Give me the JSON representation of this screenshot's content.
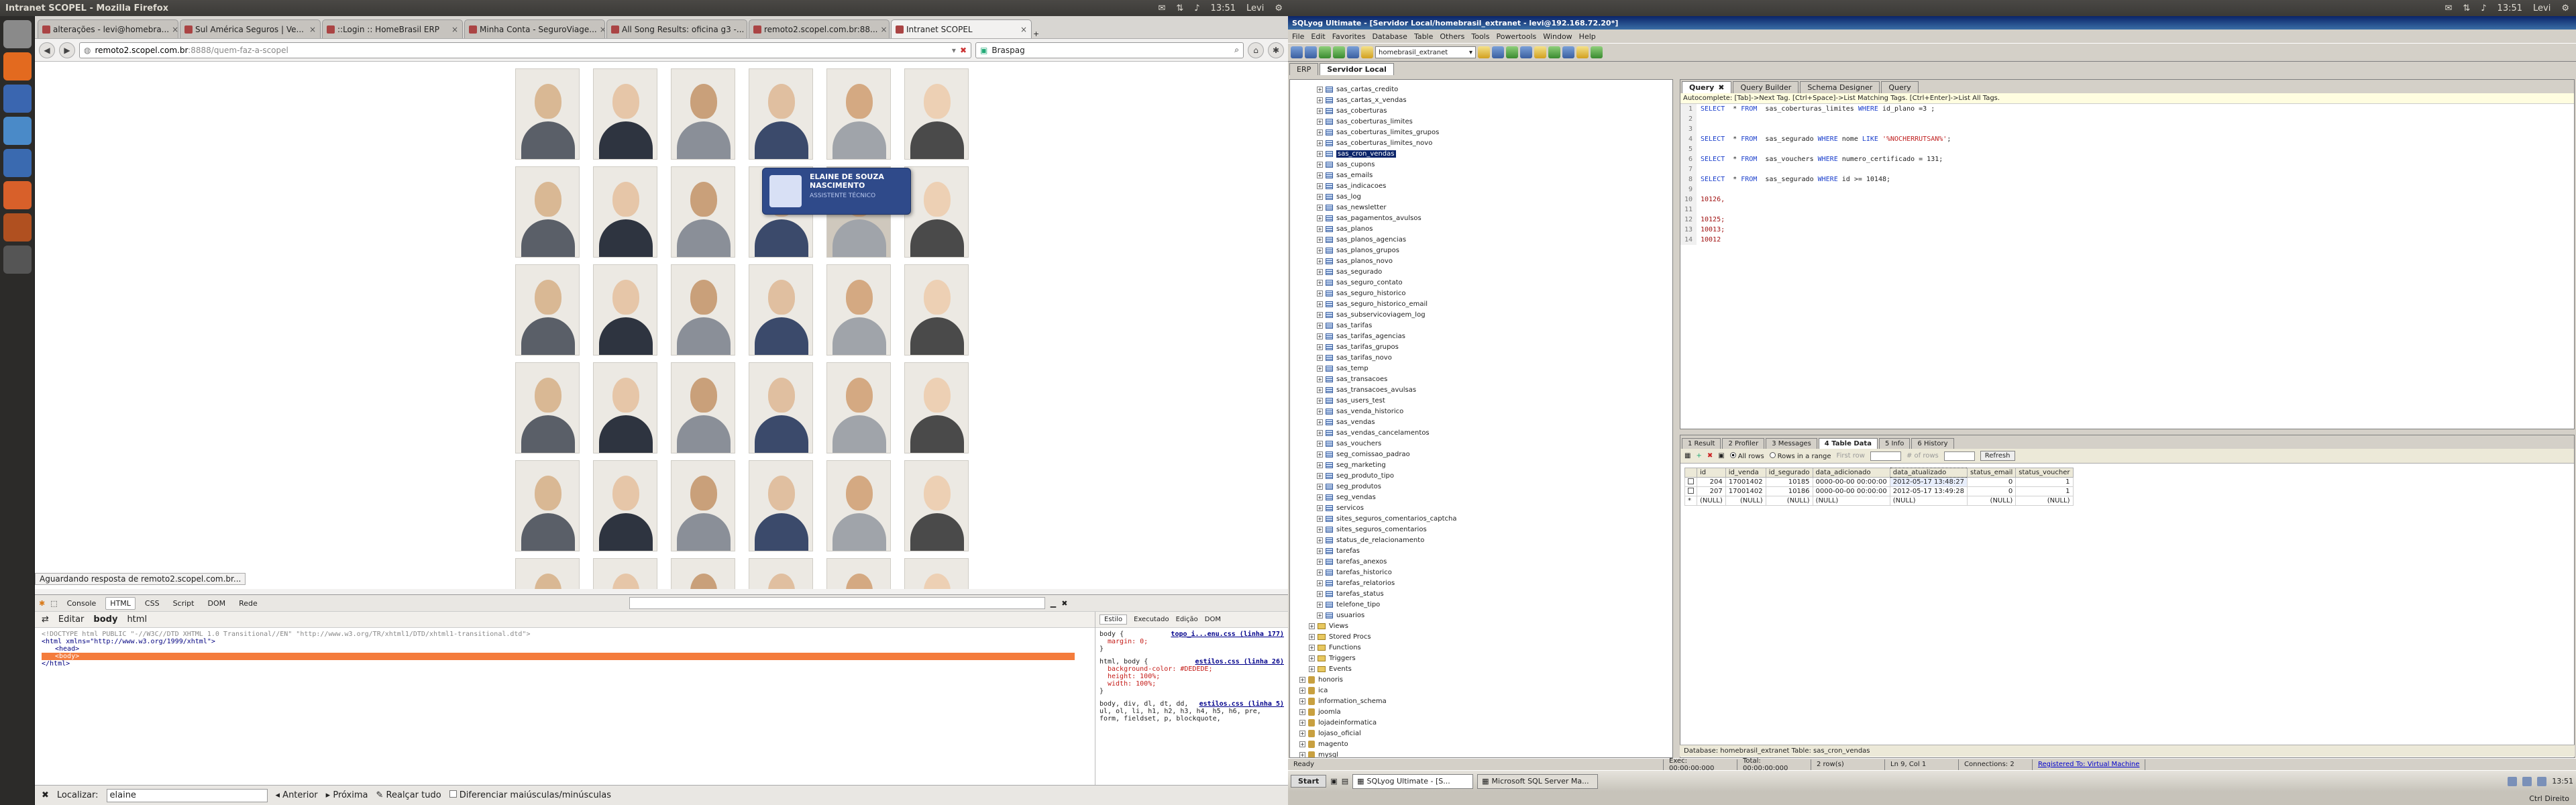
{
  "left": {
    "os_title": "Intranet SCOPEL - Mozilla Firefox",
    "tray": {
      "time": "13:51",
      "user": "Levi"
    },
    "tabs": [
      {
        "label": "alterações - levi@homebra...",
        "active": false
      },
      {
        "label": "Sul América Seguros | Ve...",
        "active": false
      },
      {
        "label": "::Login :: HomeBrasil ERP",
        "active": false
      },
      {
        "label": "Minha Conta - SeguroViage...",
        "active": false
      },
      {
        "label": "All Song Results: oficina g3 -...",
        "active": false
      },
      {
        "label": "remoto2.scopel.com.br:88...",
        "active": false
      },
      {
        "label": "Intranet SCOPEL",
        "active": true
      }
    ],
    "url": {
      "host": "remoto2.scopel.com.br",
      "path": ":8888/quem-faz-a-scopel"
    },
    "search_placeholder": "Braspag",
    "tooltip": {
      "name": "ELAINE DE SOUZA NASCIMENTO",
      "role": "ASSISTENTE TÉCNICO"
    },
    "status": "Aguardando resposta de remoto2.scopel.com.br...",
    "firebug": {
      "toolbar": [
        "Console",
        "HTML",
        "CSS",
        "Script",
        "DOM",
        "Rede"
      ],
      "active_tab": "HTML",
      "path_items": [
        "Editar",
        "body",
        "html"
      ],
      "html_lines": [
        "<!DOCTYPE html PUBLIC \"-//W3C//DTD XHTML 1.0 Transitional//EN\" \"http://www.w3.org/TR/xhtml1/DTD/xhtml1-transitional.dtd\">",
        "<html xmlns=\"http://www.w3.org/1999/xhtml\">",
        "<head>",
        "<body>",
        "</html>"
      ],
      "side_tabs": [
        "Estilo",
        "Executado",
        "Edição",
        "DOM"
      ],
      "side_active": "Estilo",
      "css_rules": [
        {
          "selector": "body {",
          "source": "topo_i...enu.css (linha 177)",
          "props": [
            "margin: 0;"
          ]
        },
        {
          "selector": "html, body {",
          "source": "estilos.css (linha 26)",
          "props": [
            "background-color: #DEDEDE;",
            "height: 100%;",
            "width: 100%;"
          ]
        },
        {
          "selector": "body, div, dl, dt, dd, ul, ol, li, h1, h2, h3, h4, h5, h6, pre, form, fieldset, p, blockquote,",
          "source": "estilos.css (linha 5)",
          "props": []
        }
      ]
    },
    "findbar": {
      "label": "Localizar:",
      "value": "elaine",
      "prev": "Anterior",
      "next": "Próxima",
      "highlight": "Realçar tudo",
      "match_case": "Diferenciar maiúsculas/minúsculas"
    }
  },
  "right": {
    "tray": {
      "time": "13:51",
      "user": "Levi"
    },
    "title": "SQLyog Ultimate - [Servidor Local/homebrasil_extranet - levi@192.168.72.20*]",
    "menu": [
      "File",
      "Edit",
      "Favorites",
      "Database",
      "Table",
      "Others",
      "Tools",
      "Powertools",
      "Window",
      "Help"
    ],
    "db_select": "homebrasil_extranet",
    "conn_tabs": [
      {
        "label": "ERP",
        "active": false
      },
      {
        "label": "Servidor Local",
        "active": true
      }
    ],
    "tree_items": [
      "sas_cartas_credito",
      "sas_cartas_x_vendas",
      "sas_coberturas",
      "sas_coberturas_limites",
      "sas_coberturas_limites_grupos",
      "sas_coberturas_limites_novo",
      "sas_cron_vendas",
      "sas_cupons",
      "sas_emails",
      "sas_indicacoes",
      "sas_log",
      "sas_newsletter",
      "sas_pagamentos_avulsos",
      "sas_planos",
      "sas_planos_agencias",
      "sas_planos_grupos",
      "sas_planos_novo",
      "sas_segurado",
      "sas_seguro_contato",
      "sas_seguro_historico",
      "sas_seguro_historico_email",
      "sas_subservicoviagem_log",
      "sas_tarifas",
      "sas_tarifas_agencias",
      "sas_tarifas_grupos",
      "sas_tarifas_novo",
      "sas_temp",
      "sas_transacoes",
      "sas_transacoes_avulsas",
      "sas_users_test",
      "sas_venda_historico",
      "sas_vendas",
      "sas_vendas_cancelamentos",
      "sas_vouchers",
      "seg_comissao_padrao",
      "seg_marketing",
      "seg_produto_tipo",
      "seg_produtos",
      "seg_vendas",
      "servicos",
      "sites_seguros_comentarios_captcha",
      "sites_seguros_comentarios",
      "status_de_relacionamento",
      "tarefas",
      "tarefas_anexos",
      "tarefas_historico",
      "tarefas_relatorios",
      "tarefas_status",
      "telefone_tipo",
      "usuarios"
    ],
    "tree_selected": "sas_cron_vendas",
    "tree_folders": [
      "Views",
      "Stored Procs",
      "Functions",
      "Triggers",
      "Events"
    ],
    "tree_dbs": [
      "honoris",
      "ica",
      "information_schema",
      "joomla",
      "lojadeinformatica",
      "lojaso_oficial",
      "magento",
      "mysql"
    ],
    "editor_tabs": [
      "Query",
      "Query Builder",
      "Schema Designer",
      "Query"
    ],
    "autocomplete": "Autocomplete: [Tab]->Next Tag. [Ctrl+Space]->List Matching Tags. [Ctrl+Enter]->List All Tags.",
    "code_lines": [
      {
        "n": "1",
        "parts": [
          [
            "kw",
            "SELECT"
          ],
          [
            "",
            "  * "
          ],
          [
            "kw",
            "FROM"
          ],
          [
            "",
            "  sas_coberturas_limites "
          ],
          [
            "kw",
            "WHERE"
          ],
          [
            "",
            " id_plano =3 ;"
          ]
        ]
      },
      {
        "n": "2",
        "parts": []
      },
      {
        "n": "3",
        "parts": []
      },
      {
        "n": "4",
        "parts": [
          [
            "kw",
            "SELECT"
          ],
          [
            "",
            "  * "
          ],
          [
            "kw",
            "FROM"
          ],
          [
            "",
            "  sas_segurado "
          ],
          [
            "kw",
            "WHERE"
          ],
          [
            "",
            " nome "
          ],
          [
            "kw",
            "LIKE"
          ],
          [
            "str",
            " '%NOCHERRUTSAN%'"
          ],
          [
            "",
            ";"
          ]
        ]
      },
      {
        "n": "5",
        "parts": []
      },
      {
        "n": "6",
        "parts": [
          [
            "kw",
            "SELECT"
          ],
          [
            "",
            "  * "
          ],
          [
            "kw",
            "FROM"
          ],
          [
            "",
            "  sas_vouchers "
          ],
          [
            "kw",
            "WHERE"
          ],
          [
            "",
            " numero_certificado = 131;"
          ]
        ]
      },
      {
        "n": "7",
        "parts": []
      },
      {
        "n": "8",
        "parts": [
          [
            "kw",
            "SELECT"
          ],
          [
            "",
            "  * "
          ],
          [
            "kw",
            "FROM"
          ],
          [
            "",
            "  sas_segurado "
          ],
          [
            "kw",
            "WHERE"
          ],
          [
            "",
            " id >= 10148;"
          ]
        ]
      },
      {
        "n": "9",
        "parts": []
      },
      {
        "n": "10",
        "parts": [
          [
            "num",
            "10126,"
          ]
        ]
      },
      {
        "n": "11",
        "parts": []
      },
      {
        "n": "12",
        "parts": [
          [
            "num",
            "10125;"
          ]
        ]
      },
      {
        "n": "13",
        "parts": [
          [
            "num",
            "10013;"
          ]
        ]
      },
      {
        "n": "14",
        "parts": [
          [
            "num",
            "10012"
          ]
        ]
      }
    ],
    "result_tabs": [
      "1 Result",
      "2 Profiler",
      "3 Messages",
      "4 Table Data",
      "5 Info",
      "6 History"
    ],
    "result_active": "4 Table Data",
    "res_tools": {
      "all_rows": "All rows",
      "rows_range": "Rows in a range",
      "first_row": "First row",
      "limit": "# of rows",
      "refresh": "Refresh"
    },
    "grid": {
      "columns": [
        "id",
        "id_venda",
        "id_segurado",
        "data_adicionado",
        "data_atualizado",
        "status_email",
        "status_voucher"
      ],
      "rows": [
        [
          "204",
          "17001402",
          "10185",
          "0000-00-00 00:00:00",
          "2012-05-17 13:48:27",
          "0",
          "1"
        ],
        [
          "207",
          "17001402",
          "10186",
          "0000-00-00 00:00:00",
          "2012-05-17 13:49:28",
          "0",
          "1"
        ],
        [
          "(NULL)",
          "(NULL)",
          "(NULL)",
          "(NULL)",
          "(NULL)",
          "(NULL)",
          "(NULL)"
        ]
      ]
    },
    "table_status": "Database: homebrasil_extranet  Table: sas_cron_vendas",
    "status_cells": [
      "Ready",
      "Exec: 00:00:00:000",
      "Total: 00:00:00:000",
      "2 row(s)",
      "Ln 9, Col 1",
      "Connections: 2"
    ],
    "status_link": "Registered To: Virtual Machine",
    "taskbar": {
      "start": "Start",
      "tasks": [
        {
          "label": "SQLyog Ultimate - [S...",
          "active": true
        },
        {
          "label": "Microsoft SQL Server Ma...",
          "active": false
        }
      ],
      "clock": "13:51"
    },
    "bottom_label": "Ctrl Direito"
  }
}
